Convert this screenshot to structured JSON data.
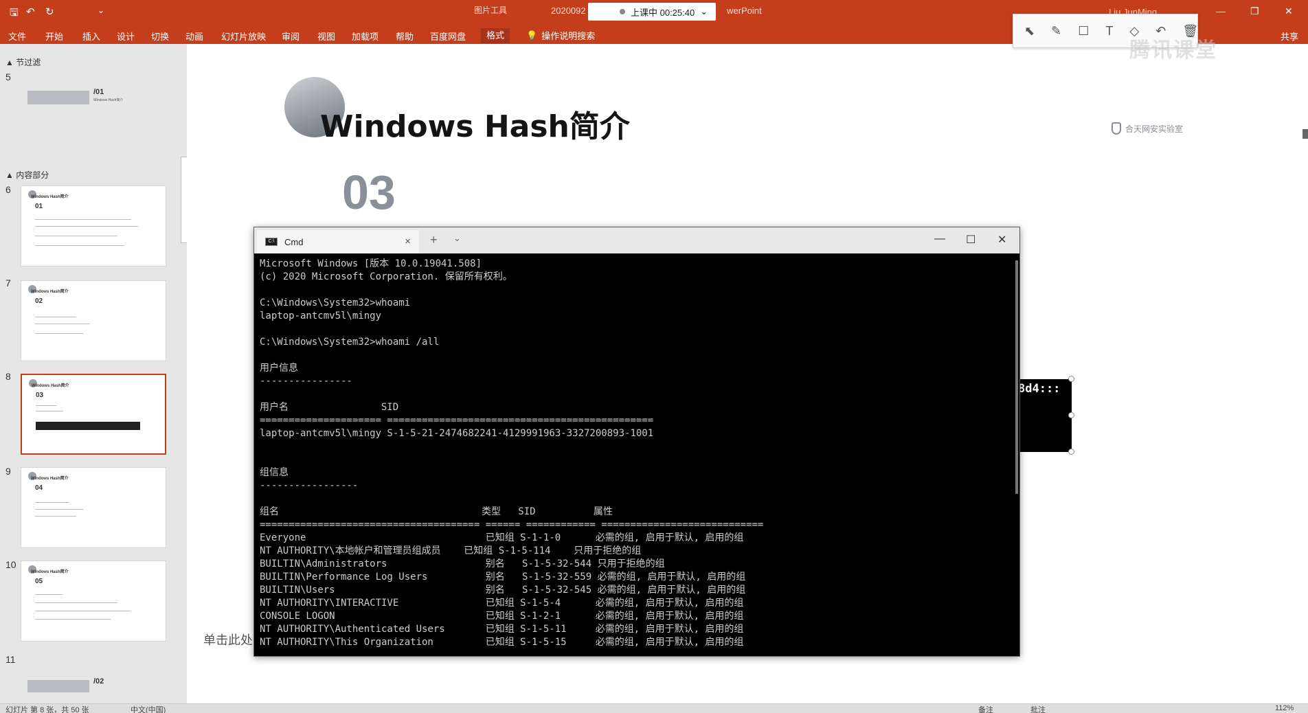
{
  "titlebar": {
    "context_tools": "图片工具",
    "doc_title_left": "2020092",
    "doc_title_right": "werPoint",
    "timer": "上课中 00:25:40",
    "timer_dropdown": "⌄",
    "user": "Liu JunMing",
    "quick_save": "🖫",
    "quick_undo": "↶",
    "quick_redo": "↻",
    "quick_custom": "⌄",
    "win_min": "—",
    "win_restore": "❐",
    "win_close": "✕"
  },
  "ribbon": {
    "tabs": [
      "文件",
      "开始",
      "插入",
      "设计",
      "切换",
      "动画",
      "幻灯片放映",
      "审阅",
      "视图",
      "加载项",
      "帮助",
      "百度网盘",
      "格式"
    ],
    "active_tab": "格式",
    "tell_me": "操作说明搜索",
    "share": "共享"
  },
  "float_toolbar": {
    "icons": [
      "pointer-icon",
      "pen-icon",
      "rect-icon",
      "text-icon",
      "eraser-icon",
      "undo-icon",
      "delete-icon"
    ],
    "glyphs": [
      "⬉",
      "✎",
      "☐",
      "T",
      "◇",
      "↶",
      "🗑"
    ],
    "watermark": "腾讯课堂"
  },
  "left_panel": {
    "sections": [
      {
        "label": "节过滤"
      },
      {
        "label": "内容部分"
      }
    ],
    "slides": [
      {
        "num": "5",
        "title": "Windows Hash简介",
        "n": "/01"
      },
      {
        "num": "6",
        "title": "Windows Hash简介",
        "n": "01"
      },
      {
        "num": "7",
        "title": "Windows Hash简介",
        "n": "02"
      },
      {
        "num": "8",
        "title": "Windows Hash简介",
        "n": "03"
      },
      {
        "num": "9",
        "title": "Windows Hash简介",
        "n": "04"
      },
      {
        "num": "10",
        "title": "Windows Hash简介",
        "n": "05"
      },
      {
        "num": "11",
        "title": "",
        "n": "/02"
      }
    ],
    "selected_slide": "8"
  },
  "slide": {
    "title": "Windows Hash简介",
    "number": "03",
    "logo_text": "合天网安实验室",
    "placeholder": "单击此处"
  },
  "pasted_image": {
    "text": "8d4:::"
  },
  "cmd": {
    "tab_title": "Cmd",
    "tab_icon_text": "C:\\",
    "tab_close": "×",
    "new_tab": "+",
    "dropdown": "⌄",
    "minimize": "—",
    "maximize": "☐",
    "close": "✕",
    "lines": [
      "Microsoft Windows [版本 10.0.19041.508]",
      "(c) 2020 Microsoft Corporation. 保留所有权利。",
      "",
      "C:\\Windows\\System32>whoami",
      "laptop-antcmv5l\\mingy",
      "",
      "C:\\Windows\\System32>whoami /all",
      "",
      "用户信息",
      "----------------",
      "",
      "用户名                SID",
      "===================== ==============================================",
      "laptop-antcmv5l\\mingy S-1-5-21-2474682241-4129991963-3327200893-1001",
      "",
      "",
      "组信息",
      "-----------------",
      "",
      "组名                                   类型   SID          属性",
      "====================================== ====== ============ ============================",
      "Everyone                               已知组 S-1-1-0      必需的组, 启用于默认, 启用的组",
      "NT AUTHORITY\\本地帐户和管理员组成员    已知组 S-1-5-114    只用于拒绝的组",
      "BUILTIN\\Administrators                 别名   S-1-5-32-544 只用于拒绝的组",
      "BUILTIN\\Performance Log Users          别名   S-1-5-32-559 必需的组, 启用于默认, 启用的组",
      "BUILTIN\\Users                          别名   S-1-5-32-545 必需的组, 启用于默认, 启用的组",
      "NT AUTHORITY\\INTERACTIVE               已知组 S-1-5-4      必需的组, 启用于默认, 启用的组",
      "CONSOLE LOGON                          已知组 S-1-2-1      必需的组, 启用于默认, 启用的组",
      "NT AUTHORITY\\Authenticated Users       已知组 S-1-5-11     必需的组, 启用于默认, 启用的组",
      "NT AUTHORITY\\This Organization         已知组 S-1-5-15     必需的组, 启用于默认, 启用的组"
    ]
  },
  "statusbar": {
    "left": "幻灯片 第 8 张，共 50 张",
    "lang": "中文(中国)",
    "notes": "备注",
    "comments": "批注",
    "zoom": "112%"
  },
  "colors": {
    "ribbon": "#c43e1c",
    "selected_border": "#c43e1c",
    "console_bg": "#000000",
    "console_fg": "#cccccc"
  }
}
